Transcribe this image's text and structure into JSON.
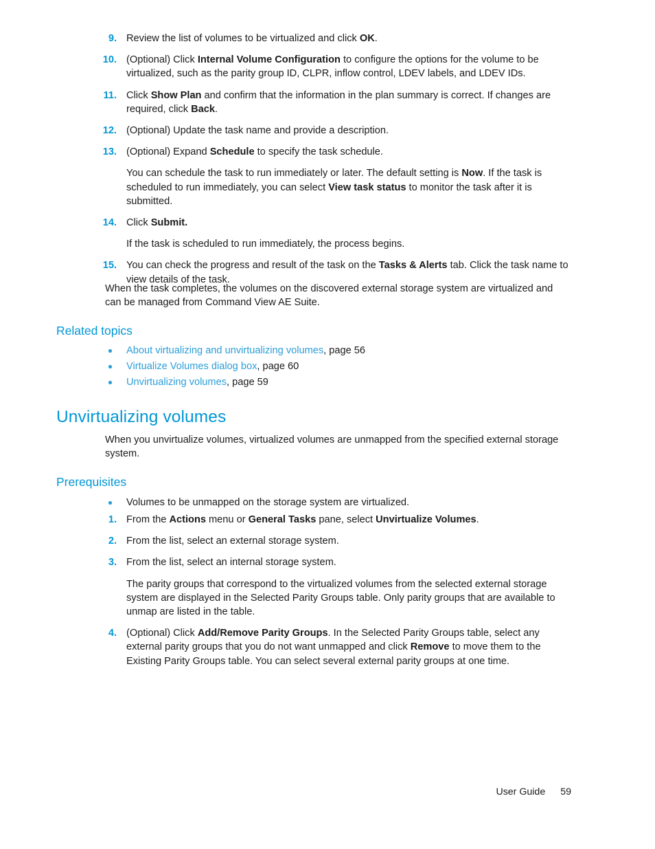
{
  "colors": {
    "accent": "#0096d6",
    "link": "#2b9ed8",
    "body": "#1a1a1a",
    "background": "#ffffff"
  },
  "steps_continued": [
    {
      "number": "9.",
      "parts": [
        {
          "t": "Review the list of volumes to be virtualized and click ",
          "b": false
        },
        {
          "t": "OK",
          "b": true
        },
        {
          "t": ".",
          "b": false
        }
      ]
    },
    {
      "number": "10.",
      "parts": [
        {
          "t": "(Optional) Click ",
          "b": false
        },
        {
          "t": "Internal Volume Configuration",
          "b": true
        },
        {
          "t": " to configure the options for the volume to be virtualized, such as the parity group ID, CLPR, inflow control, LDEV labels, and LDEV IDs.",
          "b": false
        }
      ]
    },
    {
      "number": "11.",
      "parts": [
        {
          "t": "Click ",
          "b": false
        },
        {
          "t": "Show Plan",
          "b": true
        },
        {
          "t": " and confirm that the information in the plan summary is correct. If changes are required, click ",
          "b": false
        },
        {
          "t": "Back",
          "b": true
        },
        {
          "t": ".",
          "b": false
        }
      ]
    },
    {
      "number": "12.",
      "parts": [
        {
          "t": "(Optional) Update the task name and provide a description.",
          "b": false
        }
      ]
    },
    {
      "number": "13.",
      "parts": [
        {
          "t": "(Optional) Expand ",
          "b": false
        },
        {
          "t": "Schedule",
          "b": true
        },
        {
          "t": " to specify the task schedule.",
          "b": false
        }
      ],
      "continuation": [
        {
          "t": "You can schedule the task to run immediately or later. The default setting is ",
          "b": false
        },
        {
          "t": "Now",
          "b": true
        },
        {
          "t": ". If the task is scheduled to run immediately, you can select ",
          "b": false
        },
        {
          "t": "View task status",
          "b": true
        },
        {
          "t": " to monitor the task after it is submitted.",
          "b": false
        }
      ]
    },
    {
      "number": "14.",
      "parts": [
        {
          "t": "Click ",
          "b": false
        },
        {
          "t": "Submit.",
          "b": true
        }
      ],
      "continuation": [
        {
          "t": "If the task is scheduled to run immediately, the process begins.",
          "b": false
        }
      ]
    },
    {
      "number": "15.",
      "parts": [
        {
          "t": "You can check the progress and result of the task on the ",
          "b": false
        },
        {
          "t": "Tasks & Alerts",
          "b": true
        },
        {
          "t": " tab. Click the task name to view details of the task.",
          "b": false
        }
      ]
    }
  ],
  "closing_paragraph": "When the task completes, the volumes on the discovered external storage system are virtualized and can be managed from Command View AE Suite.",
  "related_topics": {
    "heading": "Related topics",
    "items": [
      {
        "link": "About virtualizing and unvirtualizing volumes",
        "tail": ", page 56"
      },
      {
        "link": "Virtualize Volumes dialog box",
        "tail": ", page 60"
      },
      {
        "link": "Unvirtualizing volumes",
        "tail": ", page 59"
      }
    ]
  },
  "topic": {
    "heading": "Unvirtualizing volumes",
    "intro": "When you unvirtualize volumes, virtualized volumes are unmapped from the specified external storage system."
  },
  "prerequisites": {
    "heading": "Prerequisites",
    "bullets": [
      "Volumes to be unmapped on the storage system are virtualized."
    ]
  },
  "procedure_steps": [
    {
      "number": "1.",
      "parts": [
        {
          "t": "From the ",
          "b": false
        },
        {
          "t": "Actions",
          "b": true
        },
        {
          "t": " menu or ",
          "b": false
        },
        {
          "t": "General Tasks",
          "b": true
        },
        {
          "t": " pane, select ",
          "b": false
        },
        {
          "t": "Unvirtualize Volumes",
          "b": true
        },
        {
          "t": ".",
          "b": false
        }
      ]
    },
    {
      "number": "2.",
      "parts": [
        {
          "t": "From the list, select an external storage system.",
          "b": false
        }
      ]
    },
    {
      "number": "3.",
      "parts": [
        {
          "t": "From the list, select an internal storage system.",
          "b": false
        }
      ],
      "continuation": [
        {
          "t": "The parity groups that correspond to the virtualized volumes from the selected external storage system are displayed in the Selected Parity Groups table. Only parity groups that are available to unmap are listed in the table.",
          "b": false
        }
      ]
    },
    {
      "number": "4.",
      "parts": [
        {
          "t": "(Optional) Click ",
          "b": false
        },
        {
          "t": "Add/Remove Parity Groups",
          "b": true
        },
        {
          "t": ". In the Selected Parity Groups table, select any external parity groups that you do not want unmapped and click ",
          "b": false
        },
        {
          "t": "Remove",
          "b": true
        },
        {
          "t": " to move them to the Existing Parity Groups table. You can select several external parity groups at one time.",
          "b": false
        }
      ]
    }
  ],
  "footer": {
    "label": "User Guide",
    "page_number": "59"
  }
}
